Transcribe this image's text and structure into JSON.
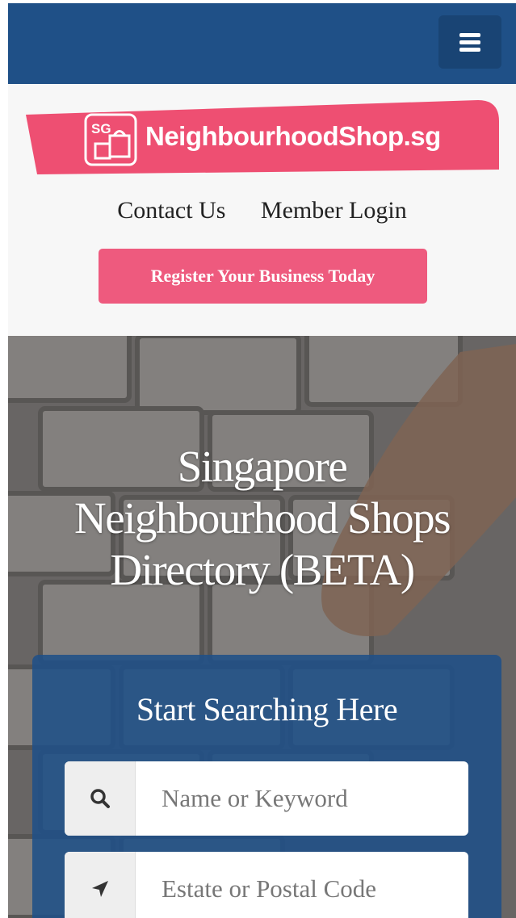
{
  "brand": {
    "name": "NeighbourhoodShop.sg",
    "mark_text": "SG",
    "banner_color": "#ee4f72"
  },
  "nav": {
    "menu_icon": "hamburger-icon",
    "links": [
      {
        "label": "Contact Us"
      },
      {
        "label": "Member Login"
      }
    ],
    "register_label": "Register Your Business Today"
  },
  "hero": {
    "title": "Singapore\nNeighbourhood Shops\nDirectory (BETA)"
  },
  "search": {
    "title": "Start Searching Here",
    "keyword": {
      "placeholder": "Name or Keyword",
      "value": "",
      "icon": "search-icon"
    },
    "location": {
      "placeholder": "Estate or Postal Code",
      "value": "",
      "icon": "location-arrow-icon"
    }
  },
  "colors": {
    "navbar": "#1f5087",
    "accent": "#ee5a7e",
    "panel": "#1f5087"
  }
}
